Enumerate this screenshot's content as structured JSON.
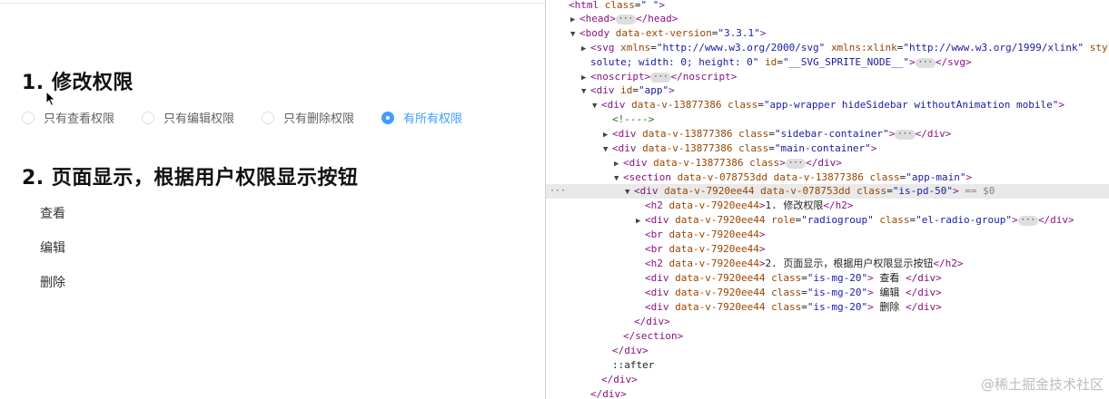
{
  "page": {
    "heading_perm": "1. 修改权限",
    "heading_show": "2. 页面显示，根据用户权限显示按钮",
    "radio_options": [
      {
        "label": "只有查看权限",
        "checked": false
      },
      {
        "label": "只有编辑权限",
        "checked": false
      },
      {
        "label": "只有删除权限",
        "checked": false
      },
      {
        "label": "有所有权限",
        "checked": true
      }
    ],
    "buttons": {
      "view": "查看",
      "edit": "编辑",
      "delete": "删除"
    }
  },
  "devtools": {
    "lines": [
      {
        "indent": 0,
        "tri": "",
        "html": "<span class=\"tok-tag\">&lt;html</span> <span class=\"tok-attr\">class</span>=<span class=\"tok-val\">\" \"</span><span class=\"tok-tag\">&gt;</span>"
      },
      {
        "indent": 1,
        "tri": "▶",
        "html": "<span class=\"tok-tag\">&lt;head&gt;</span><span class=\"ell\">···</span><span class=\"tok-tag\">&lt;/head&gt;</span>"
      },
      {
        "indent": 1,
        "tri": "▼",
        "html": "<span class=\"tok-tag\">&lt;body</span> <span class=\"tok-attr\">data-ext-version</span>=<span class=\"tok-val\">\"3.3.1\"</span><span class=\"tok-tag\">&gt;</span>"
      },
      {
        "indent": 2,
        "tri": "▶",
        "html": "<span class=\"tok-tag\">&lt;svg</span> <span class=\"tok-attr\">xmlns</span>=<span class=\"tok-val\">\"http://www.w3.org/2000/svg\"</span> <span class=\"tok-attr\">xmlns:xlink</span>=<span class=\"tok-val\">\"http://www.w3.org/1999/xlink\"</span> <span class=\"tok-attr\">style</span>"
      },
      {
        "indent": 2,
        "tri": "",
        "html": "<span class=\"tok-val\">solute; width: 0; height: 0\"</span> <span class=\"tok-attr\">id</span>=<span class=\"tok-val\">\"__SVG_SPRITE_NODE__\"</span><span class=\"tok-tag\">&gt;</span><span class=\"ell\">···</span><span class=\"tok-tag\">&lt;/svg&gt;</span>"
      },
      {
        "indent": 2,
        "tri": "▶",
        "html": "<span class=\"tok-tag\">&lt;noscript&gt;</span><span class=\"ell\">···</span><span class=\"tok-tag\">&lt;/noscript&gt;</span>"
      },
      {
        "indent": 2,
        "tri": "▼",
        "html": "<span class=\"tok-tag\">&lt;div</span> <span class=\"tok-attr\">id</span>=<span class=\"tok-val\">\"app\"</span><span class=\"tok-tag\">&gt;</span>"
      },
      {
        "indent": 3,
        "tri": "▼",
        "html": "<span class=\"tok-tag\">&lt;div</span> <span class=\"tok-attr\">data-v-13877386</span> <span class=\"tok-attr\">class</span>=<span class=\"tok-val\">\"app-wrapper hideSidebar withoutAnimation mobile\"</span><span class=\"tok-tag\">&gt;</span>"
      },
      {
        "indent": 4,
        "tri": "",
        "html": "<span class=\"tok-comment\">&lt;!----&gt;</span>"
      },
      {
        "indent": 4,
        "tri": "▶",
        "html": "<span class=\"tok-tag\">&lt;div</span> <span class=\"tok-attr\">data-v-13877386</span> <span class=\"tok-attr\">class</span>=<span class=\"tok-val\">\"sidebar-container\"</span><span class=\"tok-tag\">&gt;</span><span class=\"ell\">···</span><span class=\"tok-tag\">&lt;/div&gt;</span>"
      },
      {
        "indent": 4,
        "tri": "▼",
        "html": "<span class=\"tok-tag\">&lt;div</span> <span class=\"tok-attr\">data-v-13877386</span> <span class=\"tok-attr\">class</span>=<span class=\"tok-val\">\"main-container\"</span><span class=\"tok-tag\">&gt;</span>"
      },
      {
        "indent": 5,
        "tri": "▶",
        "html": "<span class=\"tok-tag\">&lt;div</span> <span class=\"tok-attr\">data-v-13877386</span> <span class=\"tok-attr\">class</span><span class=\"tok-tag\">&gt;</span><span class=\"ell\">···</span><span class=\"tok-tag\">&lt;/div&gt;</span>"
      },
      {
        "indent": 5,
        "tri": "▼",
        "html": "<span class=\"tok-tag\">&lt;section</span> <span class=\"tok-attr\">data-v-078753dd</span> <span class=\"tok-attr\">data-v-13877386</span> <span class=\"tok-attr\">class</span>=<span class=\"tok-val\">\"app-main\"</span><span class=\"tok-tag\">&gt;</span>"
      },
      {
        "indent": 6,
        "tri": "▼",
        "hl": true,
        "html": "<span class=\"tok-tag\">&lt;div</span> <span class=\"tok-attr\">data-v-7920ee44</span> <span class=\"tok-attr\">data-v-078753dd</span> <span class=\"tok-attr\">class</span>=<span class=\"tok-val\">\"is-pd-50\"</span><span class=\"tok-tag\">&gt;</span> <span class=\"tok-ref\">== $0</span>"
      },
      {
        "indent": 7,
        "tri": "",
        "html": "<span class=\"tok-tag\">&lt;h2</span> <span class=\"tok-attr\">data-v-7920ee44</span><span class=\"tok-tag\">&gt;</span><span class=\"tok-text\">1. 修改权限</span><span class=\"tok-tag\">&lt;/h2&gt;</span>"
      },
      {
        "indent": 7,
        "tri": "▶",
        "html": "<span class=\"tok-tag\">&lt;div</span> <span class=\"tok-attr\">data-v-7920ee44</span> <span class=\"tok-attr\">role</span>=<span class=\"tok-val\">\"radiogroup\"</span> <span class=\"tok-attr\">class</span>=<span class=\"tok-val\">\"el-radio-group\"</span><span class=\"tok-tag\">&gt;</span><span class=\"ell\">···</span><span class=\"tok-tag\">&lt;/div&gt;</span>"
      },
      {
        "indent": 7,
        "tri": "",
        "html": "<span class=\"tok-tag\">&lt;br</span> <span class=\"tok-attr\">data-v-7920ee44</span><span class=\"tok-tag\">&gt;</span>"
      },
      {
        "indent": 7,
        "tri": "",
        "html": "<span class=\"tok-tag\">&lt;br</span> <span class=\"tok-attr\">data-v-7920ee44</span><span class=\"tok-tag\">&gt;</span>"
      },
      {
        "indent": 7,
        "tri": "",
        "html": "<span class=\"tok-tag\">&lt;h2</span> <span class=\"tok-attr\">data-v-7920ee44</span><span class=\"tok-tag\">&gt;</span><span class=\"tok-text\">2. 页面显示，根据用户权限显示按钮</span><span class=\"tok-tag\">&lt;/h2&gt;</span>"
      },
      {
        "indent": 7,
        "tri": "",
        "html": "<span class=\"tok-tag\">&lt;div</span> <span class=\"tok-attr\">data-v-7920ee44</span> <span class=\"tok-attr\">class</span>=<span class=\"tok-val\">\"is-mg-20\"</span><span class=\"tok-tag\">&gt;</span><span class=\"tok-text\"> 查看 </span><span class=\"tok-tag\">&lt;/div&gt;</span>"
      },
      {
        "indent": 7,
        "tri": "",
        "html": "<span class=\"tok-tag\">&lt;div</span> <span class=\"tok-attr\">data-v-7920ee44</span> <span class=\"tok-attr\">class</span>=<span class=\"tok-val\">\"is-mg-20\"</span><span class=\"tok-tag\">&gt;</span><span class=\"tok-text\"> 编辑 </span><span class=\"tok-tag\">&lt;/div&gt;</span>"
      },
      {
        "indent": 7,
        "tri": "",
        "html": "<span class=\"tok-tag\">&lt;div</span> <span class=\"tok-attr\">data-v-7920ee44</span> <span class=\"tok-attr\">class</span>=<span class=\"tok-val\">\"is-mg-20\"</span><span class=\"tok-tag\">&gt;</span><span class=\"tok-text\"> 删除 </span><span class=\"tok-tag\">&lt;/div&gt;</span>"
      },
      {
        "indent": 6,
        "tri": "",
        "html": "<span class=\"tok-tag\">&lt;/div&gt;</span>"
      },
      {
        "indent": 5,
        "tri": "",
        "html": "<span class=\"tok-tag\">&lt;/section&gt;</span>"
      },
      {
        "indent": 4,
        "tri": "",
        "html": "<span class=\"tok-tag\">&lt;/div&gt;</span>"
      },
      {
        "indent": 4,
        "tri": "",
        "html": "<span class=\"tok-pseudo\">::after</span>"
      },
      {
        "indent": 3,
        "tri": "",
        "html": "<span class=\"tok-tag\">&lt;/div&gt;</span>"
      },
      {
        "indent": 2,
        "tri": "",
        "html": "<span class=\"tok-tag\">&lt;/div&gt;</span>"
      }
    ],
    "gutter_mark": "···"
  },
  "watermark": "@稀土掘金技术社区"
}
